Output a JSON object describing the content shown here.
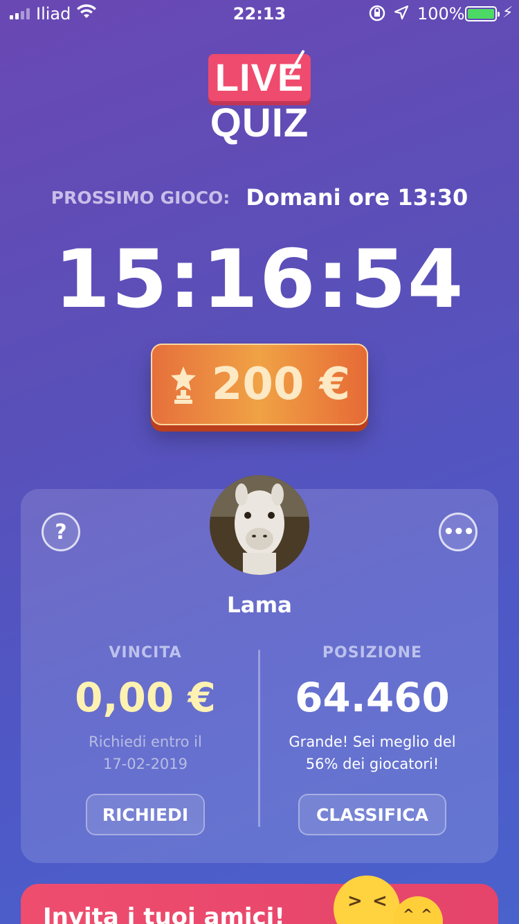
{
  "status_bar": {
    "carrier": "Iliad",
    "time": "22:13",
    "battery": "100%"
  },
  "logo": {
    "live": "LIVE",
    "quiz": "QUIZ"
  },
  "next_game": {
    "label": "PROSSIMO GIOCO:",
    "value": "Domani ore 13:30"
  },
  "countdown": "15:16:54",
  "prize": {
    "value": "200 €",
    "icon": "trophy-icon"
  },
  "profile": {
    "username": "Lama",
    "winnings": {
      "label": "VINCITA",
      "value": "0,00 €",
      "note_line1": "Richiedi entro il",
      "note_line2": "17-02-2019",
      "button": "RICHIEDI"
    },
    "position": {
      "label": "POSIZIONE",
      "value": "64.460",
      "note_line1": "Grande! Sei meglio del",
      "note_line2": "56% dei giocatori!",
      "button": "CLASSIFICA"
    },
    "help_icon": "?",
    "more_icon": "•••"
  },
  "invite": {
    "text": "Invita i tuoi amici!"
  },
  "colors": {
    "accent_red": "#ef4b6e",
    "prize_orange": "#f0a245",
    "winnings_yellow": "#fdf2b2",
    "battery_green": "#4cd964"
  }
}
